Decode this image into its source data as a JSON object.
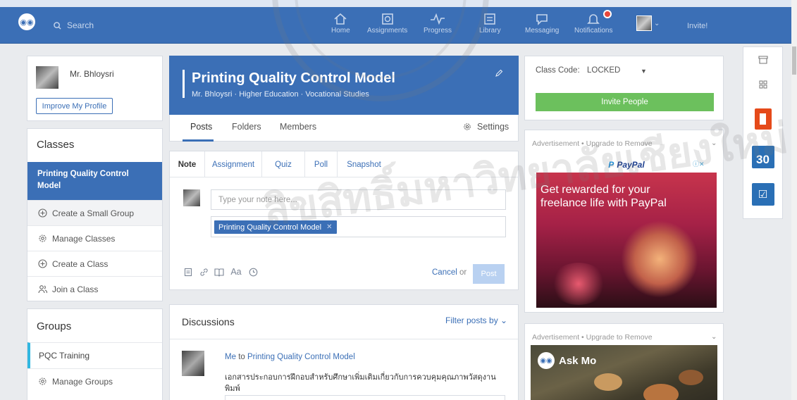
{
  "nav": {
    "search_placeholder": "Search",
    "items": [
      {
        "label": "Home",
        "icon": "home-icon"
      },
      {
        "label": "Assignments",
        "icon": "assignments-icon"
      },
      {
        "label": "Progress",
        "icon": "progress-icon"
      },
      {
        "label": "Library",
        "icon": "library-icon"
      },
      {
        "label": "Messaging",
        "icon": "messaging-icon"
      },
      {
        "label": "Notifications",
        "icon": "bell-icon"
      }
    ],
    "invite": "Invite!",
    "brand_color": "#3b6fb6"
  },
  "profile": {
    "name": "Mr. Bhloysri",
    "improve_button": "Improve My Profile"
  },
  "classes": {
    "title": "Classes",
    "active_class": "Printing Quality Control Model",
    "items": [
      {
        "label": "Create a Small Group",
        "icon": "plus-circle-icon"
      },
      {
        "label": "Manage Classes",
        "icon": "gear-icon"
      },
      {
        "label": "Create a Class",
        "icon": "plus-circle-icon"
      },
      {
        "label": "Join a Class",
        "icon": "people-icon"
      }
    ]
  },
  "groups": {
    "title": "Groups",
    "items": [
      {
        "label": "PQC Training",
        "accent": "#31b7e0"
      },
      {
        "label": "Manage Groups",
        "icon": "gear-icon"
      }
    ]
  },
  "class_header": {
    "title": "Printing Quality Control Model",
    "subtitle": "Mr. Bhloysri · Higher Education · Vocational Studies"
  },
  "class_tabs": {
    "posts": "Posts",
    "folders": "Folders",
    "members": "Members",
    "settings": "Settings"
  },
  "composer": {
    "tabs": [
      "Note",
      "Assignment",
      "Quiz",
      "Poll",
      "Snapshot"
    ],
    "placeholder": "Type your note here...",
    "recipient": "Printing Quality Control Model",
    "tools": [
      "file-icon",
      "link-icon",
      "library-icon",
      "Aa",
      "clock-icon"
    ],
    "cancel": "Cancel",
    "or": "or",
    "post": "Post"
  },
  "discussions": {
    "title": "Discussions",
    "filter": "Filter posts by",
    "post": {
      "author": "Me",
      "to": "to",
      "target": "Printing Quality Control Model",
      "body": "เอกสารประกอบการฝึกอบสำหรับศึกษาเพิ่มเติมเกี่ยวกับการควบคุมคุณภาพวัสดุงานพิมพ์"
    }
  },
  "class_code": {
    "label": "Class Code:",
    "value": "LOCKED",
    "invite_button": "Invite People"
  },
  "ads": {
    "label": "Advertisement",
    "sep": "•",
    "upgrade": "Upgrade to Remove",
    "paypal_brand": "PayPal",
    "paypal_copy": "Get rewarded for your freelance life with PayPal",
    "askmo": "Ask Mo"
  },
  "rail": {
    "calendar_day": "30"
  },
  "watermark": "ลิขสิทธิ์มหาวิทยาลัยเชียงใหม่"
}
